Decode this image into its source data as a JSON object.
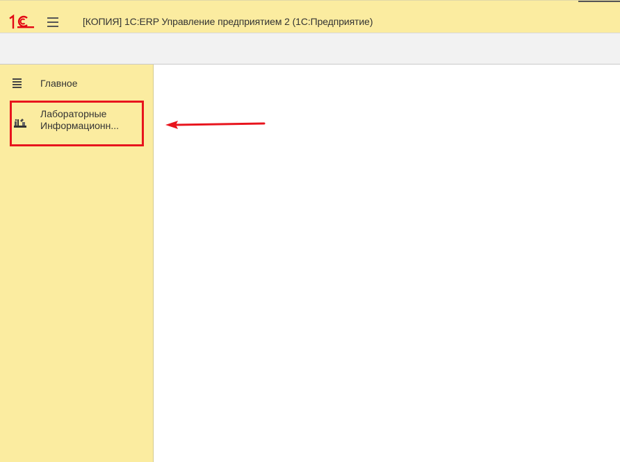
{
  "titlebar": {
    "logo": "1c-logo-icon",
    "menu_icon": "hamburger-menu-icon",
    "title": "[КОПИЯ] 1С:ERP Управление предприятием 2  (1С:Предприятие)"
  },
  "sidebar": {
    "items": [
      {
        "label": "Главное",
        "icon": "menu-lines-icon"
      },
      {
        "label_line1": "Лабораторные",
        "label_line2": "Информационн...",
        "icon": "lab-equipment-icon",
        "highlighted": true
      }
    ]
  },
  "annotation": {
    "highlight_color": "#e8141d",
    "arrow_color": "#e8141d",
    "arrow_direction": "left"
  },
  "colors": {
    "panel_yellow": "#fbeca0",
    "toolbar_gray": "#f2f2f2",
    "brand_red": "#e30613"
  }
}
